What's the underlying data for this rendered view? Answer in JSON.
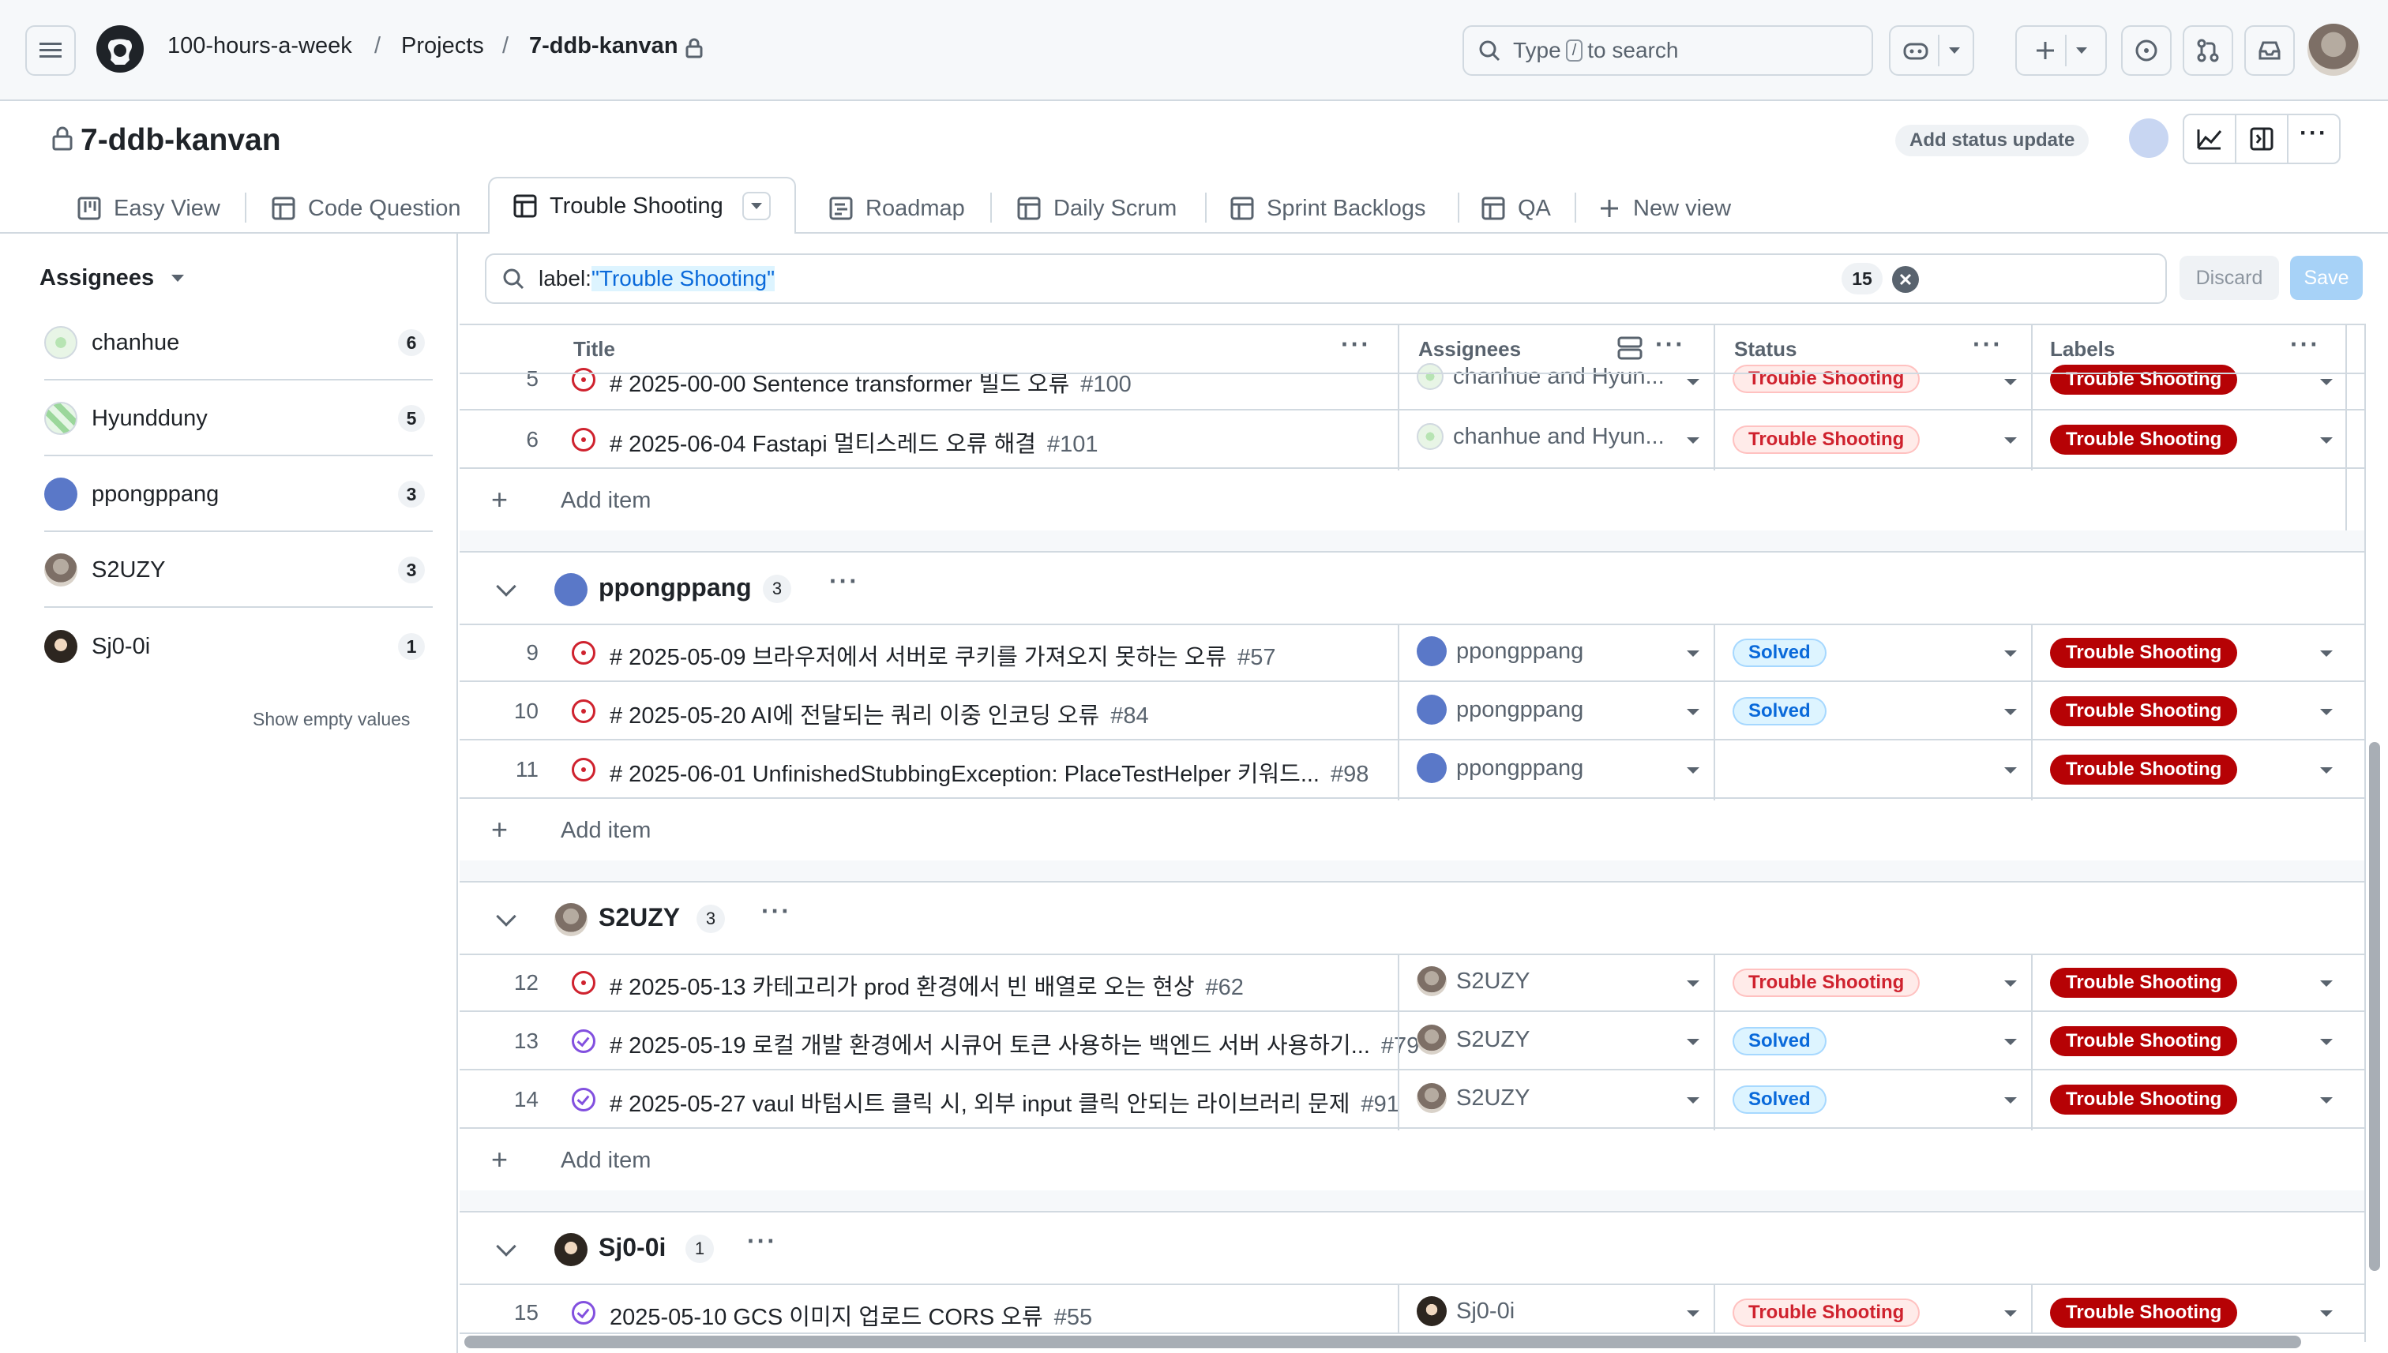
{
  "header": {
    "breadcrumb": [
      "100-hours-a-week",
      "Projects",
      "7-ddb-kanvan"
    ],
    "search_prefix": "Type",
    "search_key": "/",
    "search_suffix": "to search"
  },
  "project": {
    "title": "7-ddb-kanvan",
    "add_status_update": "Add status update"
  },
  "tabs": [
    {
      "label": "Easy View"
    },
    {
      "label": "Code Question"
    },
    {
      "label": "Trouble Shooting"
    },
    {
      "label": "Roadmap"
    },
    {
      "label": "Daily Scrum"
    },
    {
      "label": "Sprint Backlogs"
    },
    {
      "label": "QA"
    },
    {
      "label": "New view"
    }
  ],
  "sidebar": {
    "heading": "Assignees",
    "items": [
      {
        "name": "chanhue",
        "count": "6"
      },
      {
        "name": "Hyundduny",
        "count": "5"
      },
      {
        "name": "ppongppang",
        "count": "3"
      },
      {
        "name": "S2UZY",
        "count": "3"
      },
      {
        "name": "Sj0-0i",
        "count": "1"
      }
    ],
    "show_empty": "Show empty values"
  },
  "filter": {
    "prefix": "label:",
    "value": "\"Trouble Shooting\"",
    "count": "15",
    "discard": "Discard",
    "save": "Save"
  },
  "columns": {
    "title": "Title",
    "assignees": "Assignees",
    "status": "Status",
    "labels": "Labels"
  },
  "groups": [
    {
      "name": "ppongppang",
      "count": "3"
    },
    {
      "name": "S2UZY",
      "count": "3"
    },
    {
      "name": "Sj0-0i",
      "count": "1"
    }
  ],
  "rows": [
    {
      "num": "5",
      "title": "# 2025-00-00 Sentence transformer 빌드 오류",
      "issue": "#100",
      "assignee": "chanhue and Hyun...",
      "status": "Trouble Shooting",
      "label": "Trouble Shooting"
    },
    {
      "num": "6",
      "title": "# 2025-06-04 Fastapi 멀티스레드 오류 해결",
      "issue": "#101",
      "assignee": "chanhue and Hyun...",
      "status": "Trouble Shooting",
      "label": "Trouble Shooting"
    },
    {
      "num": "9",
      "title": "# 2025-05-09 브라우저에서 서버로 쿠키를 가져오지 못하는 오류",
      "issue": "#57",
      "assignee": "ppongppang",
      "status": "Solved",
      "label": "Trouble Shooting"
    },
    {
      "num": "10",
      "title": "# 2025-05-20 AI에 전달되는 쿼리 이중 인코딩 오류",
      "issue": "#84",
      "assignee": "ppongppang",
      "status": "Solved",
      "label": "Trouble Shooting"
    },
    {
      "num": "11",
      "title": "# 2025-06-01 UnfinishedStubbingException: PlaceTestHelper 키워드...",
      "issue": "#98",
      "assignee": "ppongppang",
      "status": "",
      "label": "Trouble Shooting"
    },
    {
      "num": "12",
      "title": "# 2025-05-13 카테고리가 prod 환경에서 빈 배열로 오는 현상",
      "issue": "#62",
      "assignee": "S2UZY",
      "status": "Trouble Shooting",
      "label": "Trouble Shooting"
    },
    {
      "num": "13",
      "title": "# 2025-05-19 로컬 개발 환경에서 시큐어 토큰 사용하는 백엔드 서버 사용하기...",
      "issue": "#79",
      "assignee": "S2UZY",
      "status": "Solved",
      "label": "Trouble Shooting"
    },
    {
      "num": "14",
      "title": "# 2025-05-27 vaul 바텀시트 클릭 시, 외부 input 클릭 안되는 라이브러리 문제",
      "issue": "#91",
      "assignee": "S2UZY",
      "status": "Solved",
      "label": "Trouble Shooting"
    },
    {
      "num": "15",
      "title": "2025-05-10 GCS 이미지 업로드 CORS 오류",
      "issue": "#55",
      "assignee": "Sj0-0i",
      "status": "Trouble Shooting",
      "label": "Trouble Shooting"
    }
  ],
  "add_item": "Add item",
  "colors": {
    "label_bg": "#b60205",
    "open_issue": "#cf222e",
    "closed_issue": "#8250df",
    "accent": "#0969da"
  }
}
